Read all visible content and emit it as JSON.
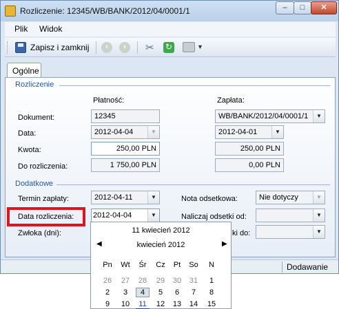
{
  "window": {
    "title": "Rozliczenie: 12345/WB/BANK/2012/04/0001/1",
    "controls": {
      "minimize": "–",
      "maximize": "□",
      "close": "✕"
    }
  },
  "menu": {
    "items": [
      "Plik",
      "Widok"
    ]
  },
  "toolbar": {
    "save_label": "Zapisz i zamknij",
    "icons": [
      "save-icon",
      "back-icon",
      "forward-icon",
      "tools-icon",
      "refresh-icon",
      "print-icon",
      "chevron-down-icon"
    ]
  },
  "tabs": [
    {
      "label": "Ogólne",
      "active": true
    }
  ],
  "rozliczenie": {
    "title": "Rozliczenie",
    "col_platnosc": "Płatność:",
    "col_zaplata": "Zapłata:",
    "rows": {
      "dokument": {
        "label": "Dokument:",
        "platnosc": "12345",
        "zaplata": "WB/BANK/2012/04/0001/1"
      },
      "data": {
        "label": "Data:",
        "platnosc": "2012-04-04",
        "zaplata": "2012-04-01"
      },
      "kwota": {
        "label": "Kwota:",
        "platnosc": "250,00 PLN",
        "zaplata": "250,00 PLN"
      },
      "do_rozliczenia": {
        "label": "Do rozliczenia:",
        "platnosc": "1 750,00 PLN",
        "zaplata": "0,00 PLN"
      }
    }
  },
  "dodatkowe": {
    "title": "Dodatkowe",
    "termin_zaplaty": {
      "label": "Termin zapłaty:",
      "value": "2012-04-11"
    },
    "data_rozliczenia": {
      "label": "Data rozliczenia:",
      "value": "2012-04-04"
    },
    "zwloka": {
      "label": "Zwłoka (dni):"
    },
    "nota_odsetkowa": {
      "label": "Nota odsetkowa:",
      "value": "Nie dotyczy"
    },
    "naliczaj_od": {
      "label": "Naliczaj odsetki od:",
      "value": ""
    },
    "naliczaj_do": {
      "label": "ki do:",
      "value": ""
    }
  },
  "status": {
    "text": "Dodawanie"
  },
  "calendar": {
    "today_label": "11 kwiecień 2012",
    "month_label": "kwiecień 2012",
    "weekdays": [
      "Pn",
      "Wt",
      "Śr",
      "Cz",
      "Pt",
      "So",
      "N"
    ],
    "weeks": [
      [
        "26",
        "27",
        "28",
        "29",
        "30",
        "31",
        "1"
      ],
      [
        "2",
        "3",
        "4",
        "5",
        "6",
        "7",
        "8"
      ],
      [
        "9",
        "10",
        "11",
        "12",
        "13",
        "14",
        "15"
      ]
    ],
    "selected_day": "4",
    "today_day": "11"
  },
  "colors": {
    "accent": "#2b55a0",
    "highlight": "#e0141b"
  }
}
